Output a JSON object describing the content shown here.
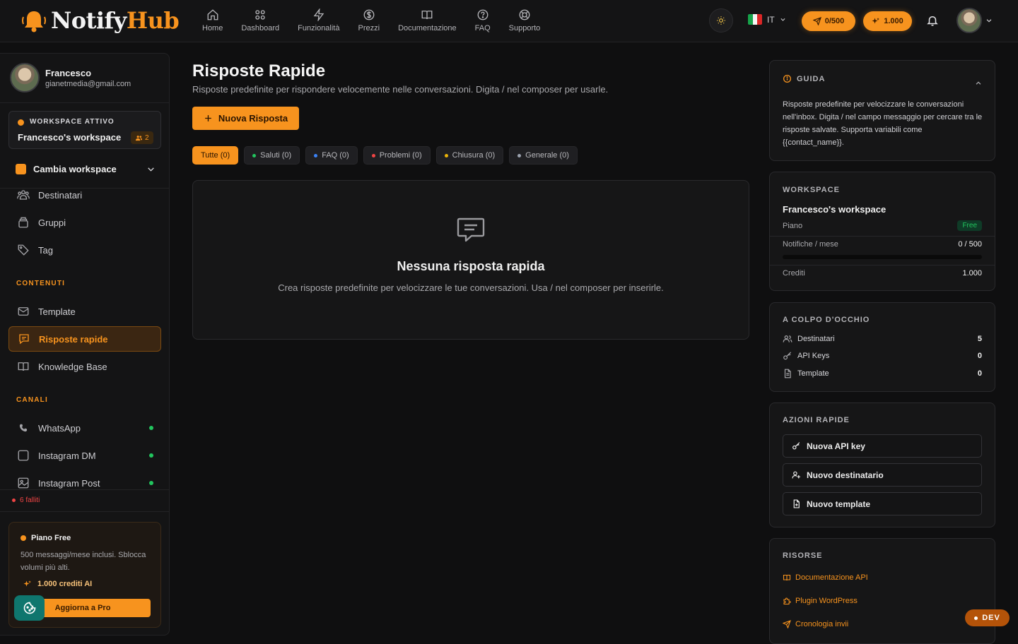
{
  "brand": {
    "name_part1": "Notify",
    "name_part2": "Hub"
  },
  "nav": [
    {
      "label": "Home",
      "icon": "home-icon"
    },
    {
      "label": "Dashboard",
      "icon": "grid-icon"
    },
    {
      "label": "Funzionalità",
      "icon": "bolt-icon"
    },
    {
      "label": "Prezzi",
      "icon": "dollar-icon"
    },
    {
      "label": "Documentazione",
      "icon": "book-icon"
    },
    {
      "label": "FAQ",
      "icon": "help-icon"
    },
    {
      "label": "Supporto",
      "icon": "lifebuoy-icon"
    }
  ],
  "topbar": {
    "language": "IT",
    "sends": "0/500",
    "credits": "1.000"
  },
  "user": {
    "name": "Francesco",
    "email": "gianetmedia@gmail.com"
  },
  "workspace_box": {
    "label": "WORKSPACE ATTIVO",
    "name": "Francesco's workspace",
    "members": "2",
    "switch_label": "Cambia workspace"
  },
  "sidebar": {
    "items_top": [
      "Destinatari",
      "Gruppi",
      "Tag"
    ],
    "section_content": "CONTENUTI",
    "items_content": [
      "Template",
      "Risposte rapide",
      "Knowledge Base"
    ],
    "section_channels": "CANALI",
    "items_channels": [
      "WhatsApp",
      "Instagram DM",
      "Instagram Post"
    ],
    "failed": "6 falliti"
  },
  "plan": {
    "title": "Piano Free",
    "desc": "500 messaggi/mese inclusi. Sblocca volumi più alti.",
    "credits": "1.000 crediti AI",
    "upgrade": "Aggiorna a Pro"
  },
  "main": {
    "title": "Risposte Rapide",
    "subtitle": "Risposte predefinite per rispondere velocemente nelle conversazioni. Digita / nel composer per usarle.",
    "new_button": "Nuova Risposta",
    "filters": [
      {
        "label": "Tutte (0)",
        "color": ""
      },
      {
        "label": "Saluti (0)",
        "color": "#22c55e"
      },
      {
        "label": "FAQ (0)",
        "color": "#3b82f6"
      },
      {
        "label": "Problemi (0)",
        "color": "#ef4444"
      },
      {
        "label": "Chiusura (0)",
        "color": "#eab308"
      },
      {
        "label": "Generale (0)",
        "color": "#9ca3af"
      }
    ],
    "empty_title": "Nessuna risposta rapida",
    "empty_sub": "Crea risposte predefinite per velocizzare le tue conversazioni. Usa / nel composer per inserirle."
  },
  "guide": {
    "label": "GUIDA",
    "text": "Risposte predefinite per velocizzare le conversazioni nell'inbox. Digita / nel campo messaggio per cercare tra le risposte salvate. Supporta variabili come {{contact_name}}."
  },
  "workspace_card": {
    "label": "WORKSPACE",
    "name": "Francesco's workspace",
    "plan_key": "Piano",
    "plan_val": "Free",
    "notif_key": "Notifiche / mese",
    "notif_val": "0 / 500",
    "notif_fraction": 0,
    "credits_key": "Crediti",
    "credits_val": "1.000"
  },
  "glance": {
    "label": "A COLPO D'OCCHIO",
    "rows": [
      {
        "label": "Destinatari",
        "value": "5"
      },
      {
        "label": "API Keys",
        "value": "0"
      },
      {
        "label": "Template",
        "value": "0"
      }
    ]
  },
  "quick_actions": {
    "label": "AZIONI RAPIDE",
    "buttons": [
      "Nuova API key",
      "Nuovo destinatario",
      "Nuovo template"
    ]
  },
  "resources": {
    "label": "RISORSE",
    "links": [
      "Documentazione API",
      "Plugin WordPress",
      "Cronologia invii"
    ]
  },
  "dev_badge": "DEV",
  "colors": {
    "accent": "#f7931e",
    "background": "#0f0f10",
    "success": "#22c55e",
    "danger": "#ef4444"
  }
}
